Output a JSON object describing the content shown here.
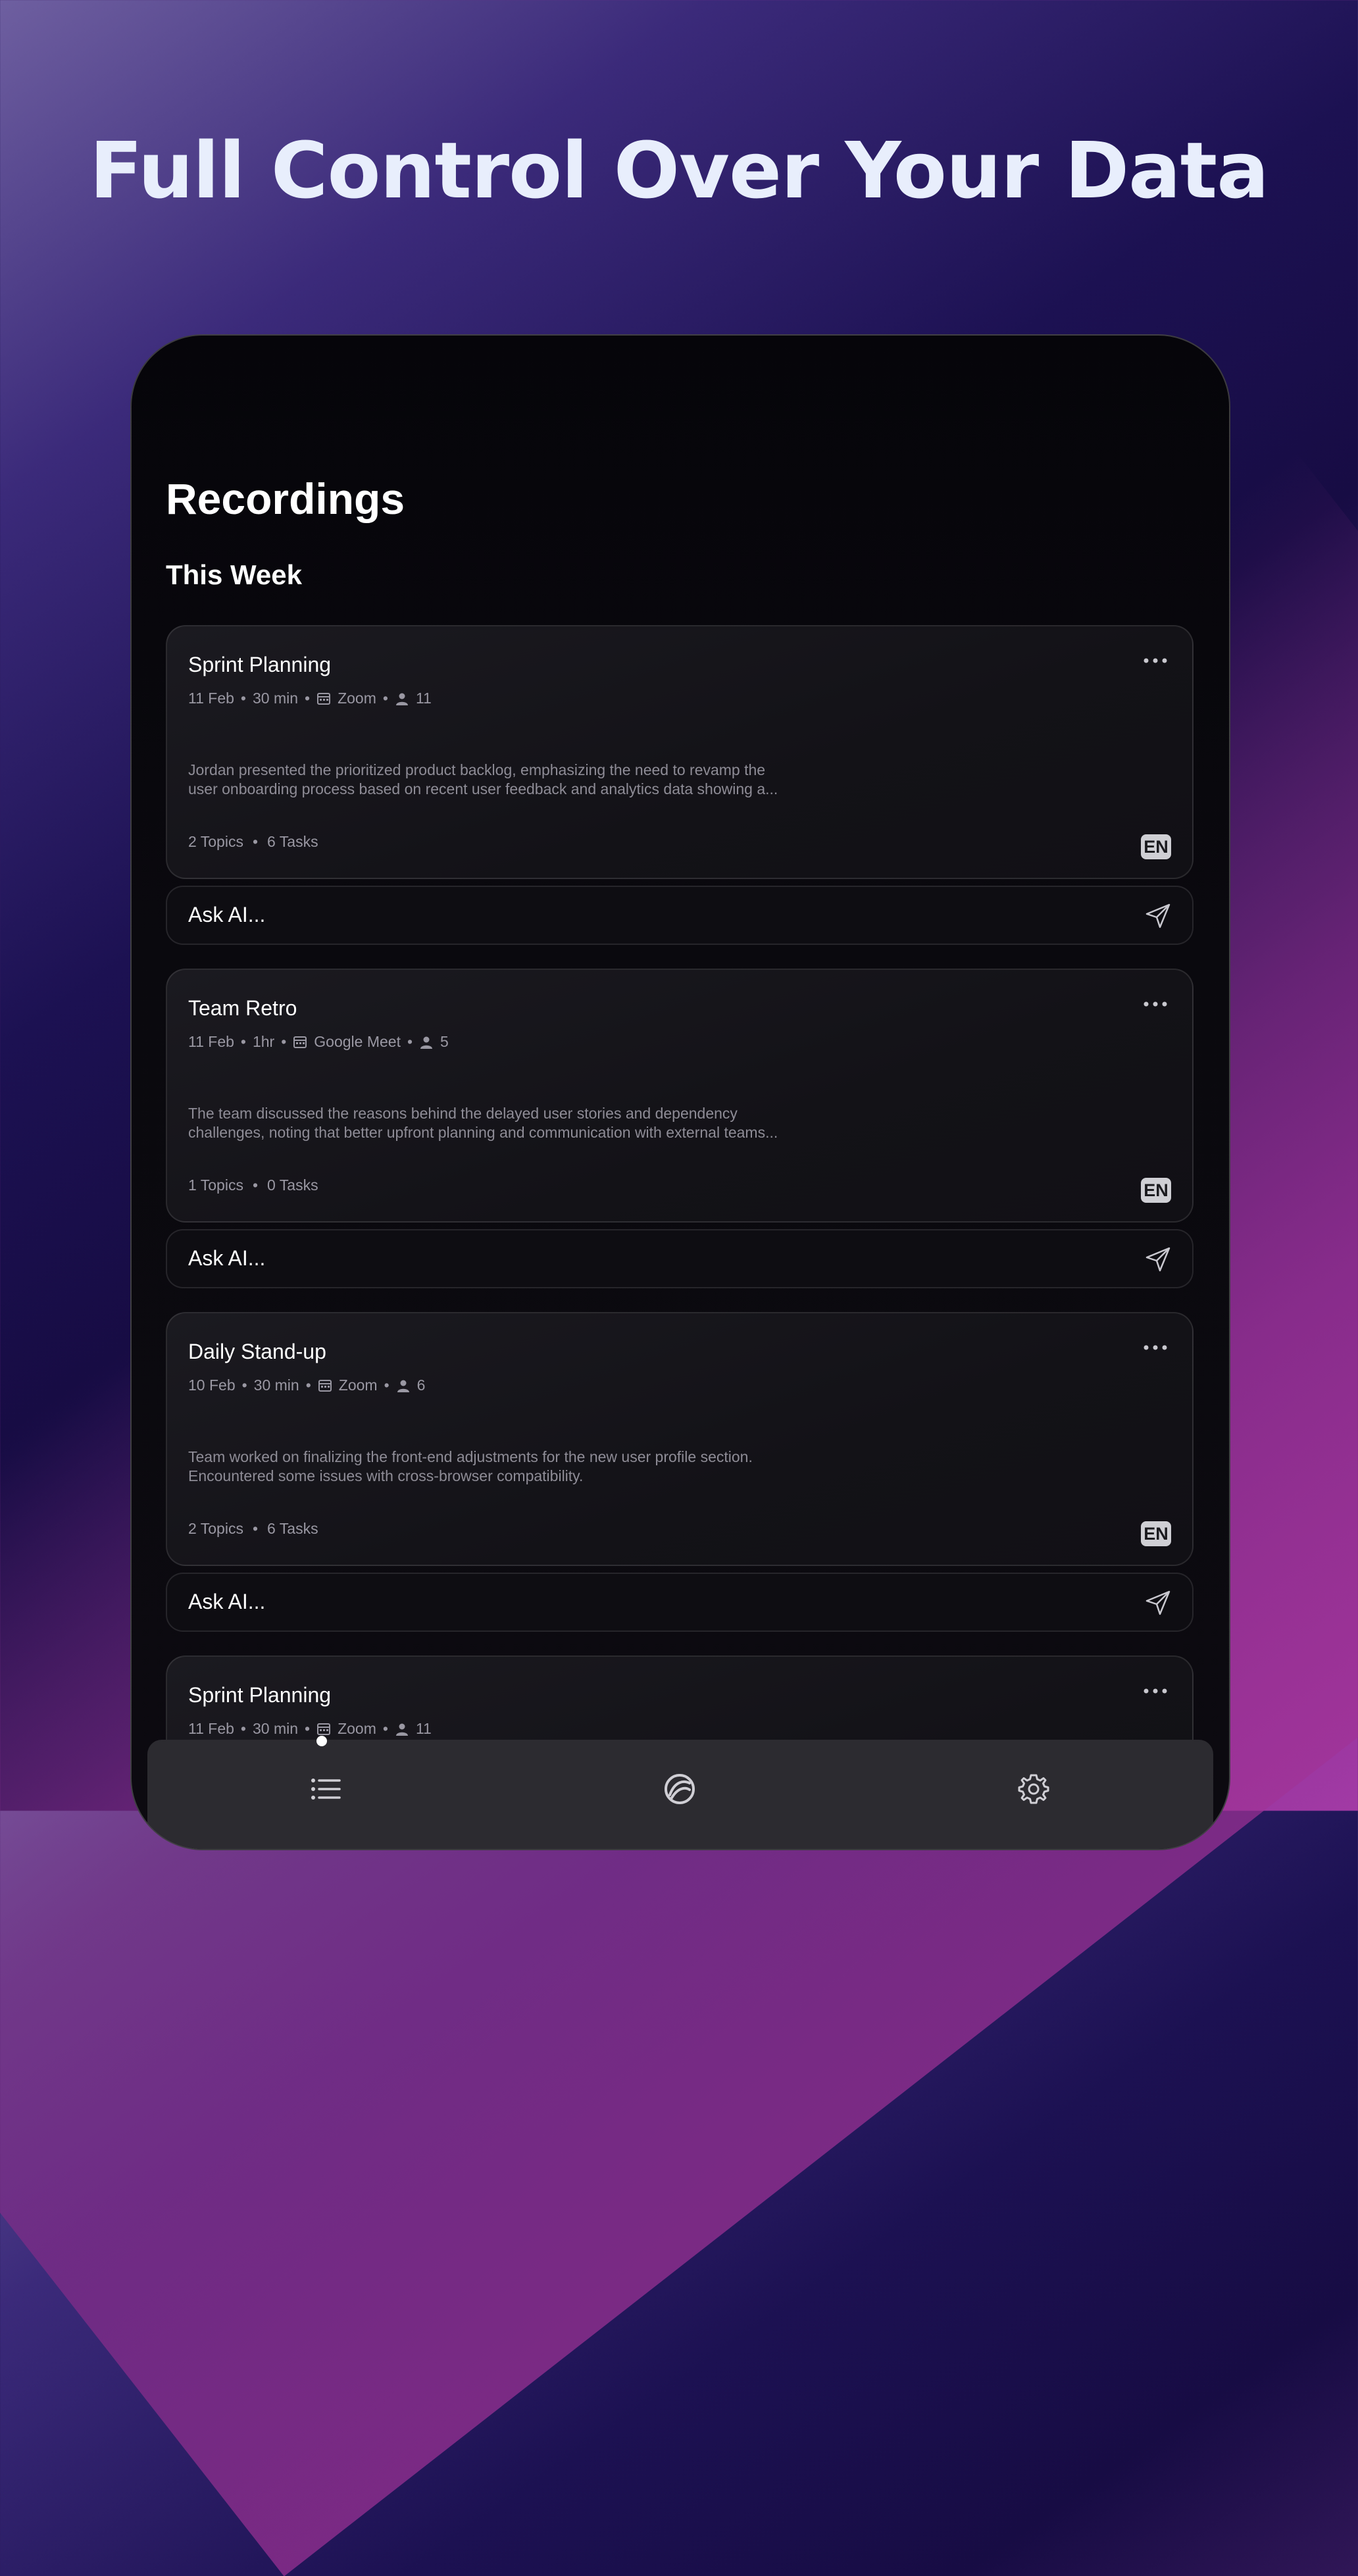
{
  "headline": "Full Control Over Your Data",
  "screen": {
    "title": "Recordings",
    "section": "This Week"
  },
  "recordings": [
    {
      "title": "Sprint Planning",
      "date": "11 Feb",
      "duration": "30 min",
      "platform": "Zoom",
      "participants": "11",
      "summary": "Jordan presented the prioritized product backlog, emphasizing the need to revamp the user onboarding process based on recent user feedback and analytics data showing a...",
      "topics": "2 Topics",
      "tasks": "6 Tasks",
      "lang": "EN"
    },
    {
      "title": "Team Retro",
      "date": "11 Feb",
      "duration": "1hr",
      "platform": "Google Meet",
      "participants": "5",
      "summary": "The team discussed the reasons behind the delayed user stories and dependency challenges, noting that better upfront planning and communication with external teams...",
      "topics": "1 Topics",
      "tasks": "0 Tasks",
      "lang": "EN"
    },
    {
      "title": "Daily Stand-up",
      "date": "10 Feb",
      "duration": "30 min",
      "platform": "Zoom",
      "participants": "6",
      "summary": "Team worked on finalizing the front-end adjustments for the new user profile section. Encountered some issues with cross-browser compatibility.",
      "topics": "2 Topics",
      "tasks": "6 Tasks",
      "lang": "EN"
    },
    {
      "title": "Sprint Planning",
      "date": "11 Feb",
      "duration": "30 min",
      "platform": "Zoom",
      "participants": "11"
    }
  ],
  "ask_ai": {
    "label": "Ask AI..."
  },
  "tabbar": {
    "items": [
      {
        "icon": "list-icon",
        "active": true
      },
      {
        "icon": "app-logo-icon",
        "active": false
      },
      {
        "icon": "gear-icon",
        "active": false
      }
    ]
  }
}
